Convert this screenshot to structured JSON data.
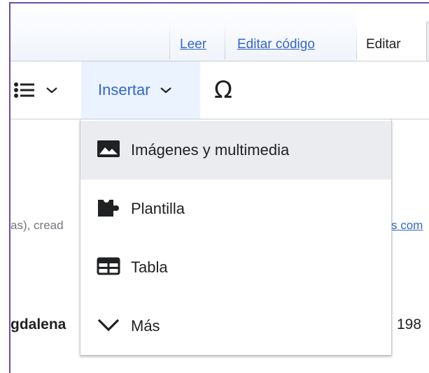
{
  "tabs": {
    "read": "Leer",
    "edit_source": "Editar código",
    "edit": "Editar"
  },
  "toolbar": {
    "insert_label": "Insertar",
    "special_char": "Ω"
  },
  "insert_menu": {
    "items": [
      {
        "label": "Imágenes y multimedia",
        "icon": "image-icon",
        "highlighted": true
      },
      {
        "label": "Plantilla",
        "icon": "puzzle-icon"
      },
      {
        "label": "Tabla",
        "icon": "table-icon"
      },
      {
        "label": "Más",
        "icon": "chevron-down-icon"
      }
    ]
  },
  "page_fragments": {
    "left_line1": "as), cread",
    "right_line1": "s com",
    "left_line2": "gdalena",
    "right_line2": "198"
  },
  "colors": {
    "link": "#3366cc",
    "insert_bg": "#eaf3ff",
    "highlight_bg": "#eaecf0",
    "frame_border": "#6b4fa3"
  }
}
